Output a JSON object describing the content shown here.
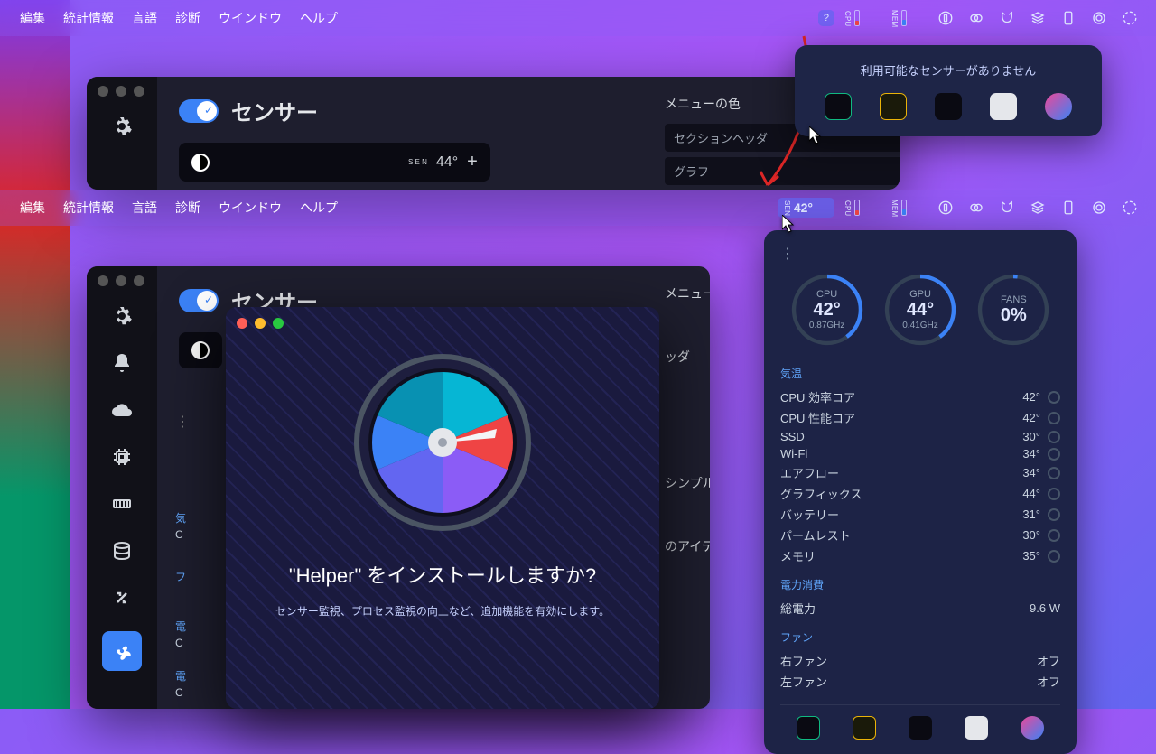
{
  "menubar": {
    "items": [
      "編集",
      "統計情報",
      "言語",
      "診断",
      "ウインドウ",
      "ヘルプ"
    ],
    "status_unknown": "?",
    "sen_label": "S\nE\nN",
    "cpu_label": "C\nP\nU",
    "mem_label": "M\nE\nM",
    "sen_temp_top": "44°",
    "sen_temp_bottom": "42°"
  },
  "settings": {
    "title": "センサー",
    "preview_temp": "44°",
    "menu_color_label": "メニューの色",
    "row_section_header": "セクションヘッダ",
    "row_graph": "グラフ",
    "row_header_partial": "ッダ",
    "row_simple_partial": "シンプル",
    "row_items_partial": "のアイテム"
  },
  "popup_top": {
    "message": "利用可能なセンサーがありません"
  },
  "sensor_panel": {
    "gauges": [
      {
        "name": "CPU",
        "value": "42°",
        "sub": "0.87GHz"
      },
      {
        "name": "GPU",
        "value": "44°",
        "sub": "0.41GHz"
      },
      {
        "name": "FANS",
        "value": "0%",
        "sub": ""
      }
    ],
    "temp_section": "気温",
    "temps": [
      {
        "label": "CPU 効率コア",
        "value": "42°"
      },
      {
        "label": "CPU 性能コア",
        "value": "42°"
      },
      {
        "label": "SSD",
        "value": "30°"
      },
      {
        "label": "Wi-Fi",
        "value": "34°"
      },
      {
        "label": "エアフロー",
        "value": "34°"
      },
      {
        "label": "グラフィックス",
        "value": "44°"
      },
      {
        "label": "バッテリー",
        "value": "31°"
      },
      {
        "label": "パームレスト",
        "value": "30°"
      },
      {
        "label": "メモリ",
        "value": "35°"
      }
    ],
    "power_section": "電力消費",
    "power_label": "総電力",
    "power_value": "9.6 W",
    "fan_section": "ファン",
    "fans": [
      {
        "label": "右ファン",
        "value": "オフ"
      },
      {
        "label": "左ファン",
        "value": "オフ"
      }
    ]
  },
  "install": {
    "title": "\"Helper\" をインストールしますか?",
    "body": "センサー監視、プロセス監視の向上など、追加機能を有効にします。"
  },
  "sw2_labels": {
    "menu_color": "メニューの色",
    "section_temp_initial": "気",
    "section_temp_under": "C",
    "section_f_initial": "フ",
    "section_e1": "電",
    "section_e1_under": "C",
    "section_e2": "電",
    "section_e2_under": "C"
  }
}
